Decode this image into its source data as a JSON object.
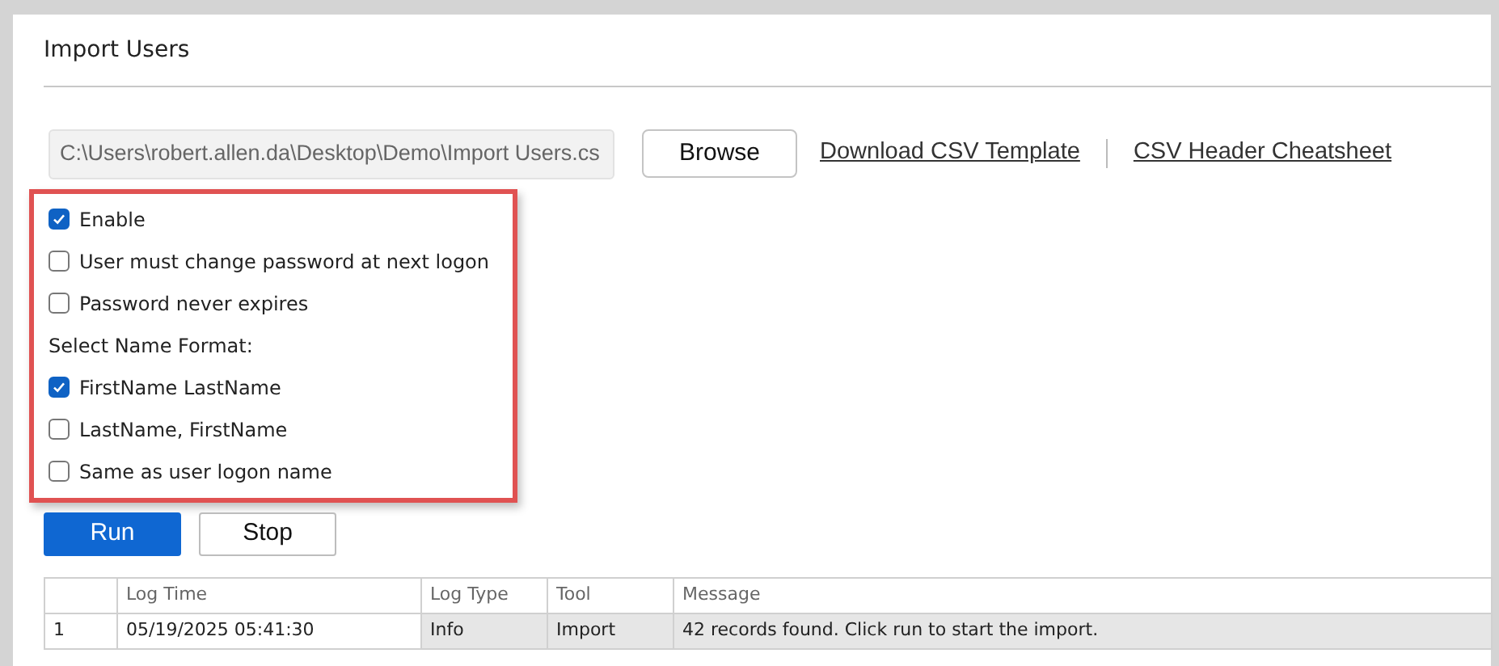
{
  "title": "Import Users",
  "file_path": {
    "value": "C:\\Users\\robert.allen.da\\Desktop\\Demo\\Import Users.cs"
  },
  "browse_button": "Browse",
  "links": [
    "Download CSV Template",
    "CSV Header Cheatsheet"
  ],
  "options": [
    {
      "label": "Enable",
      "checked": true
    },
    {
      "label": "User must change password at next logon",
      "checked": false
    },
    {
      "label": "Password never expires",
      "checked": false
    }
  ],
  "name_format": {
    "label": "Select Name Format:",
    "options": [
      {
        "label": "FirstName LastName",
        "checked": true
      },
      {
        "label": "LastName, FirstName",
        "checked": false
      },
      {
        "label": "Same as user logon name",
        "checked": false
      }
    ]
  },
  "highlighted": true,
  "buttons": [
    {
      "label": "Run",
      "kind": "primary"
    },
    {
      "label": "Stop",
      "kind": "secondary"
    }
  ],
  "log_table": {
    "columns": [
      "",
      "Log Time",
      "Log Type",
      "Tool",
      "Message"
    ],
    "rows": [
      [
        "1",
        "05/19/2025 05:41:30",
        "Info",
        "Import",
        "42 records found. Click run to start the import."
      ]
    ]
  }
}
